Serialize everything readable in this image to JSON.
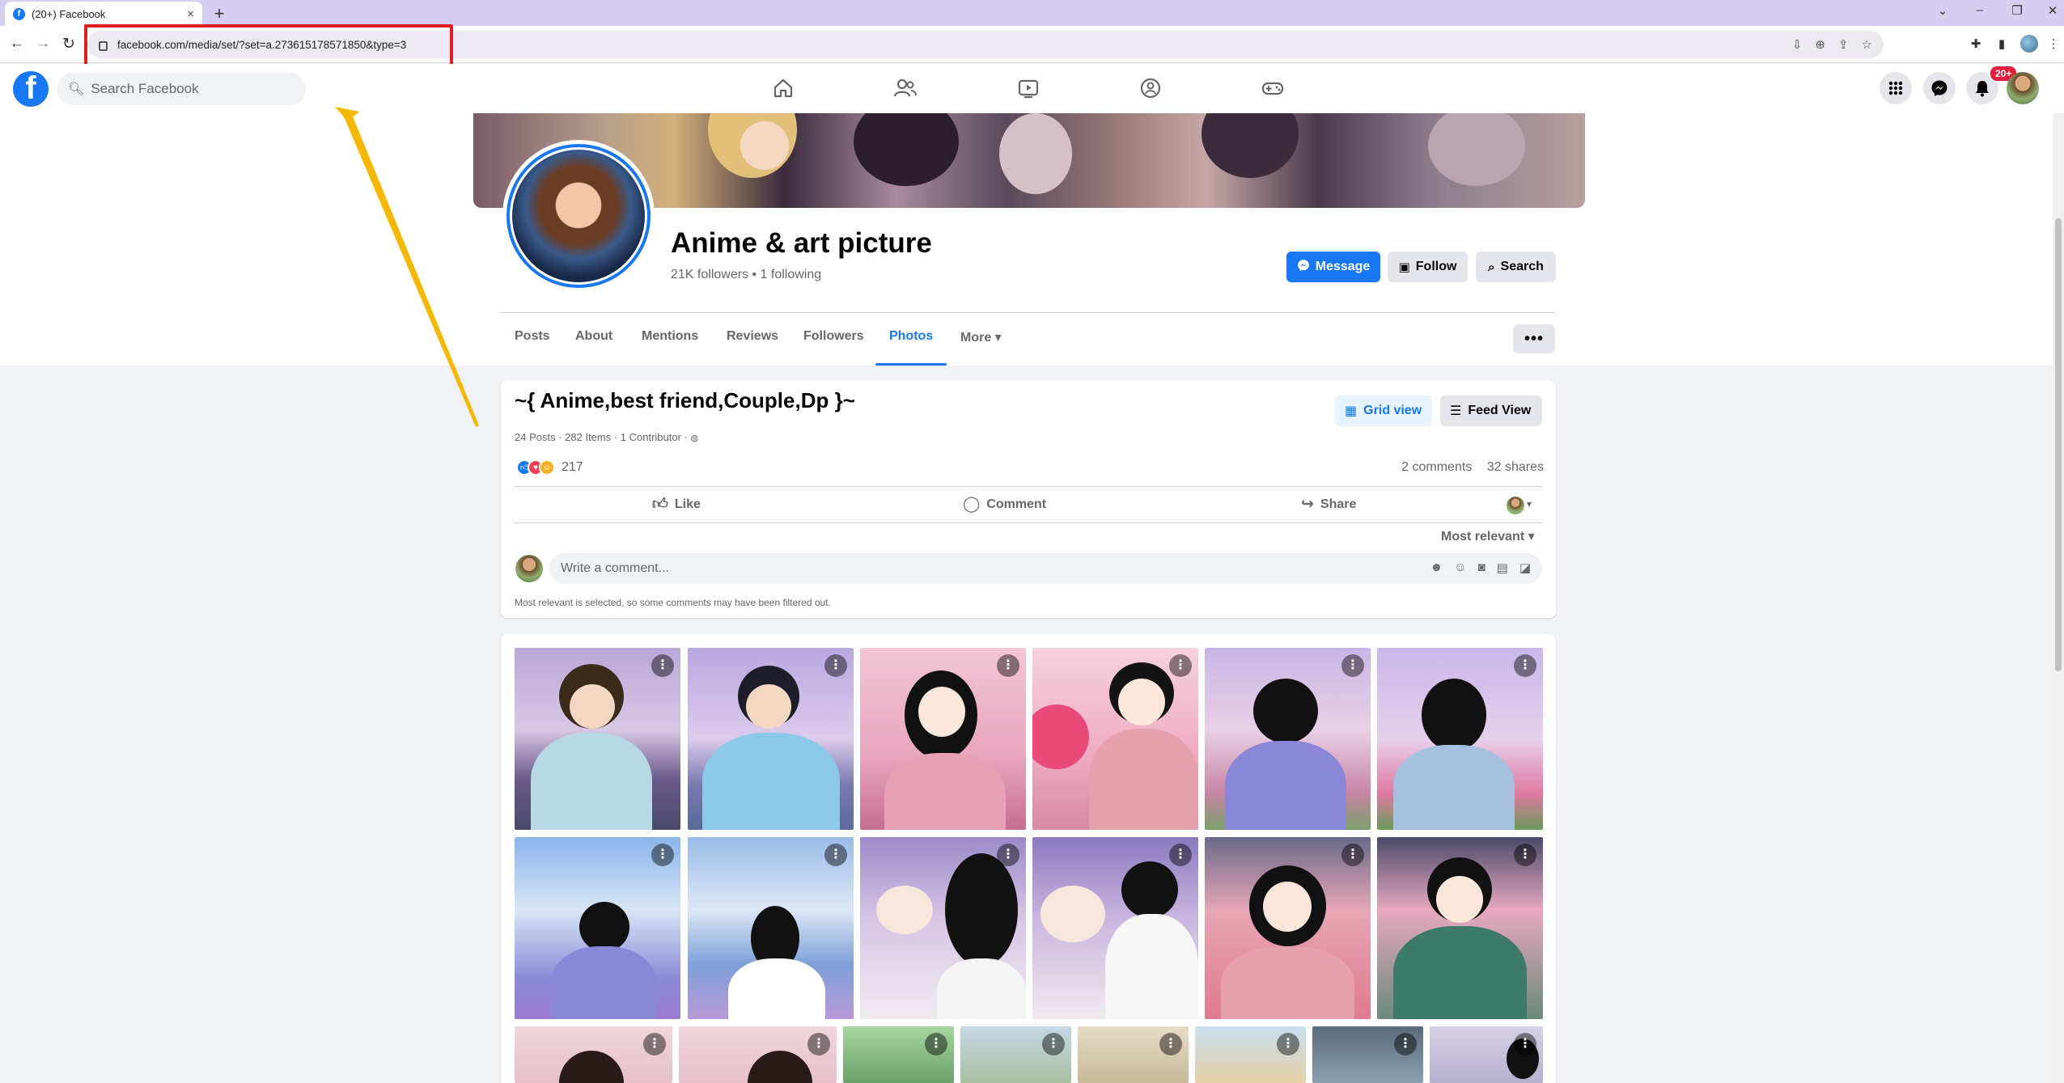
{
  "browser": {
    "tab_title": "(20+) Facebook",
    "tab_close": "×",
    "new_tab": "+",
    "url": "facebook.com/media/set/?set=a.273615178571850&type=3",
    "window_controls": [
      "⌄",
      "–",
      "❐",
      "✕"
    ]
  },
  "fb_nav": {
    "search_placeholder": "Search Facebook",
    "notifications_badge": "20+"
  },
  "profile": {
    "name": "Anime & art picture",
    "stats": "21K followers • 1 following",
    "message_button": "Message",
    "follow_button": "Follow",
    "search_button": "Search",
    "tabs": [
      "Posts",
      "About",
      "Mentions",
      "Reviews",
      "Followers",
      "Photos",
      "More ▾"
    ],
    "active_tab": "Photos",
    "more_menu": "•••"
  },
  "album": {
    "title": "~{ Anime,best friend,Couple,Dp }~",
    "meta": "24 Posts · 282 Items · 1 Contributor ·",
    "grid_view": "Grid view",
    "feed_view": "Feed View",
    "reaction_count": "217",
    "comments": "2 comments",
    "shares": "32 shares",
    "like": "Like",
    "comment": "Comment",
    "share": "Share",
    "most_relevant": "Most relevant ▾",
    "comment_placeholder": "Write a comment...",
    "filter_note": "Most relevant is selected, so some comments may have been filtered out."
  },
  "colors": {
    "fb_blue": "#1877f2",
    "highlight_box": "#e02020",
    "arrow": "#f5b800"
  }
}
